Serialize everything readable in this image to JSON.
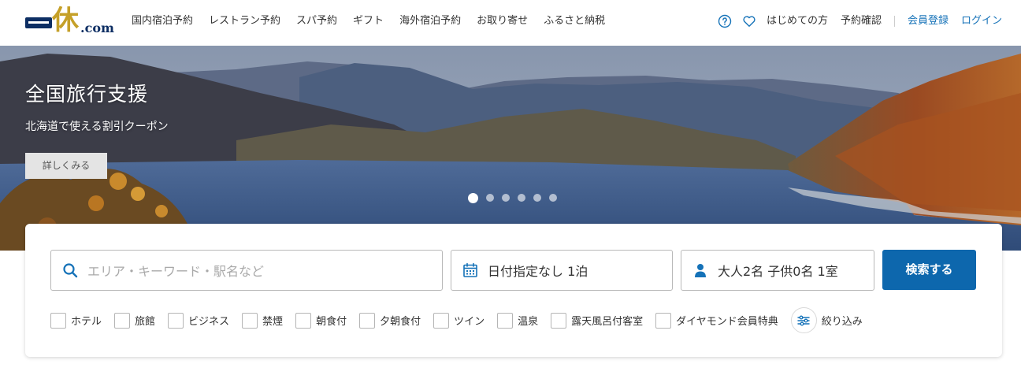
{
  "header": {
    "logo_kanji": "休",
    "logo_com": ".com",
    "nav": [
      "国内宿泊予約",
      "レストラン予約",
      "スパ予約",
      "ギフト",
      "海外宿泊予約",
      "お取り寄せ",
      "ふるさと納税"
    ],
    "util": {
      "first_time": "はじめての方",
      "booking_check": "予約確認",
      "register": "会員登録",
      "login": "ログイン"
    }
  },
  "hero": {
    "title": "全国旅行支援",
    "subtitle": "北海道で使える割引クーポン",
    "button": "詳しくみる",
    "slide_count": 6,
    "active_slide": 1
  },
  "search": {
    "keyword_placeholder": "エリア・キーワード・駅名など",
    "date_value": "日付指定なし 1泊",
    "people_value": "大人2名 子供0名 1室",
    "submit": "検索する",
    "filters": [
      "ホテル",
      "旅館",
      "ビジネス",
      "禁煙",
      "朝食付",
      "夕朝食付",
      "ツイン",
      "温泉",
      "露天風呂付客室",
      "ダイヤモンド会員特典"
    ],
    "refine": "絞り込み"
  },
  "colors": {
    "brand_navy": "#0d2e63",
    "brand_gold": "#c5a028",
    "link_blue": "#1572b8",
    "button_blue": "#0d67ad"
  }
}
